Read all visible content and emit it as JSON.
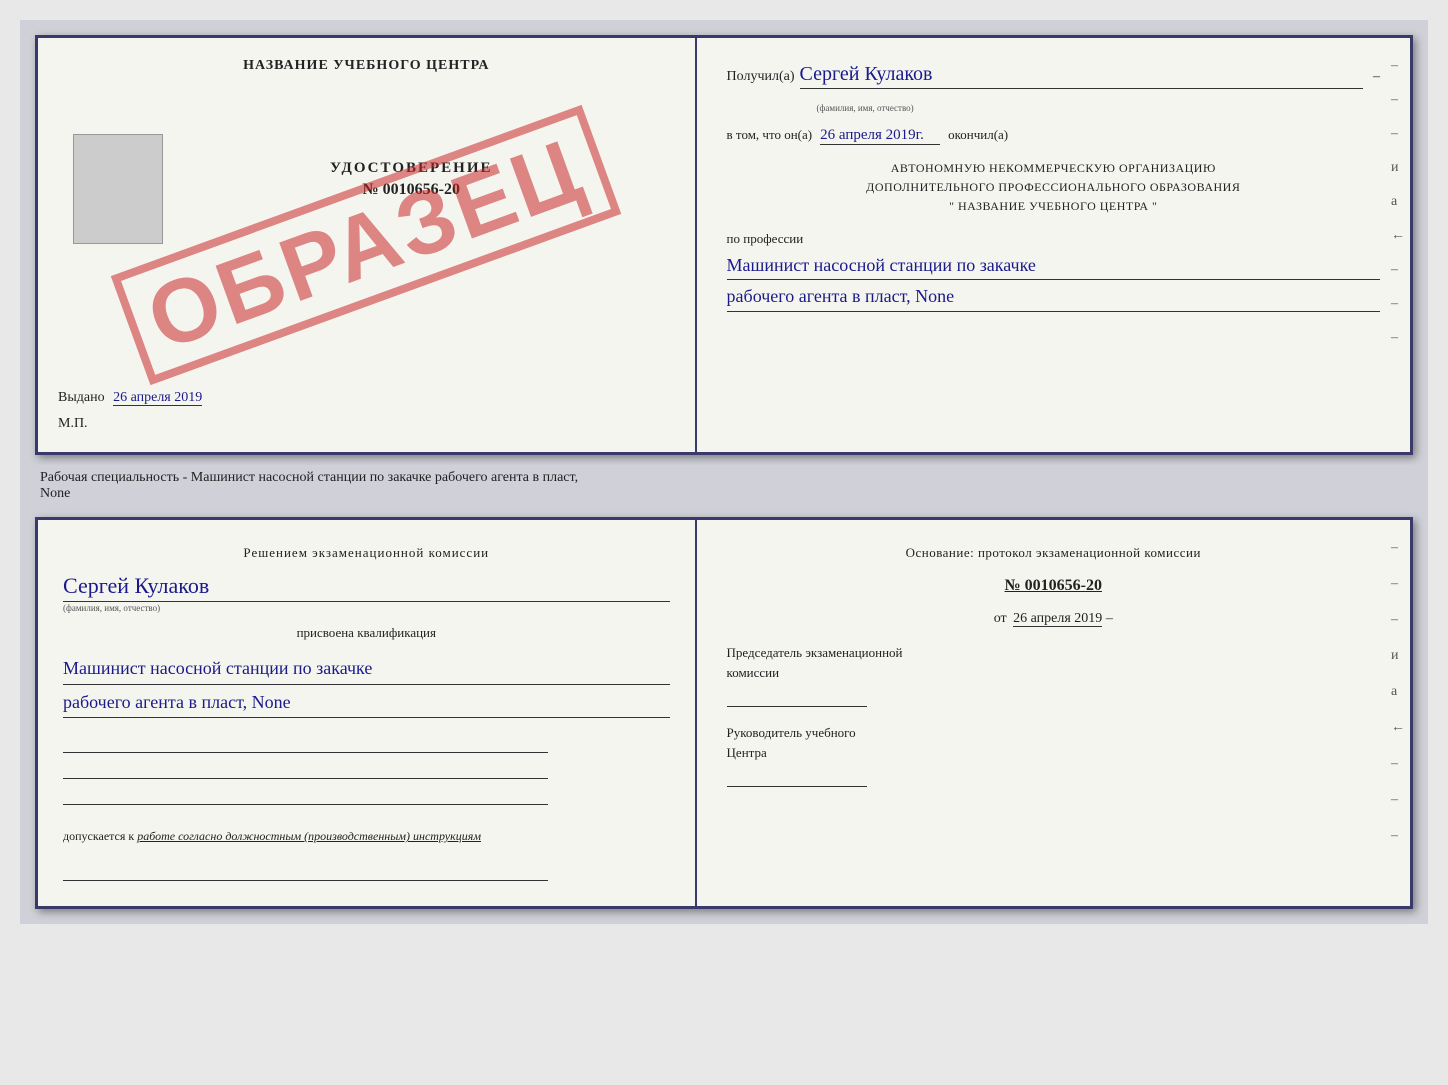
{
  "top_cert": {
    "left": {
      "title": "НАЗВАНИЕ УЧЕБНОГО ЦЕНТРА",
      "obrazets": "ОБРАЗЕЦ",
      "udostoverenie_label": "УДОСТОВЕРЕНИЕ",
      "number": "№ 0010656-20",
      "vydano_prefix": "Выдано",
      "vydano_date": "26 апреля 2019",
      "mp": "М.П."
    },
    "right": {
      "poluchil_prefix": "Получил(а)",
      "recipient_name": "Сергей Кулаков",
      "fio_hint": "(фамилия, имя, отчество)",
      "dash": "–",
      "vtom_prefix": "в том, что он(а)",
      "completed_date": "26 апреля 2019г.",
      "okochil": "окончил(а)",
      "org_line1": "АВТОНОМНУЮ НЕКОММЕРЧЕСКУЮ ОРГАНИЗАЦИЮ",
      "org_line2": "ДОПОЛНИТЕЛЬНОГО ПРОФЕССИОНАЛЬНОГО ОБРАЗОВАНИЯ",
      "org_line3": "\"  НАЗВАНИЕ УЧЕБНОГО ЦЕНТРА  \"",
      "po_professii": "по профессии",
      "qualification1": "Машинист насосной станции по закачке",
      "qualification2": "рабочего агента в пласт, None",
      "dashes": [
        "–",
        "–",
        "–",
        "и",
        "а",
        "←",
        "–",
        "–",
        "–"
      ]
    }
  },
  "description": "Рабочая специальность - Машинист насосной станции по закачке рабочего агента в пласт,",
  "description2": "None",
  "bottom_cert": {
    "left": {
      "resheniem": "Решением экзаменационной комиссии",
      "name": "Сергей Кулаков",
      "fio_hint": "(фамилия, имя, отчество)",
      "prisvoena": "присвоена квалификация",
      "qualification1": "Машинист насосной станции по закачке",
      "qualification2": "рабочего агента в пласт, None",
      "dopuskaetsya_prefix": "допускается к",
      "dopuskaetsya_italic": "работе согласно должностным (производственным) инструкциям"
    },
    "right": {
      "osnovanie": "Основание: протокол экзаменационной комиссии",
      "number": "№ 0010656-20",
      "ot_prefix": "от",
      "ot_date": "26 апреля 2019",
      "predsedatel_line1": "Председатель экзаменационной",
      "predsedatel_line2": "комиссии",
      "rukovoditel_line1": "Руководитель учебного",
      "rukovoditel_line2": "Центра",
      "dashes": [
        "–",
        "–",
        "–",
        "и",
        "а",
        "←",
        "–",
        "–",
        "–"
      ]
    }
  }
}
